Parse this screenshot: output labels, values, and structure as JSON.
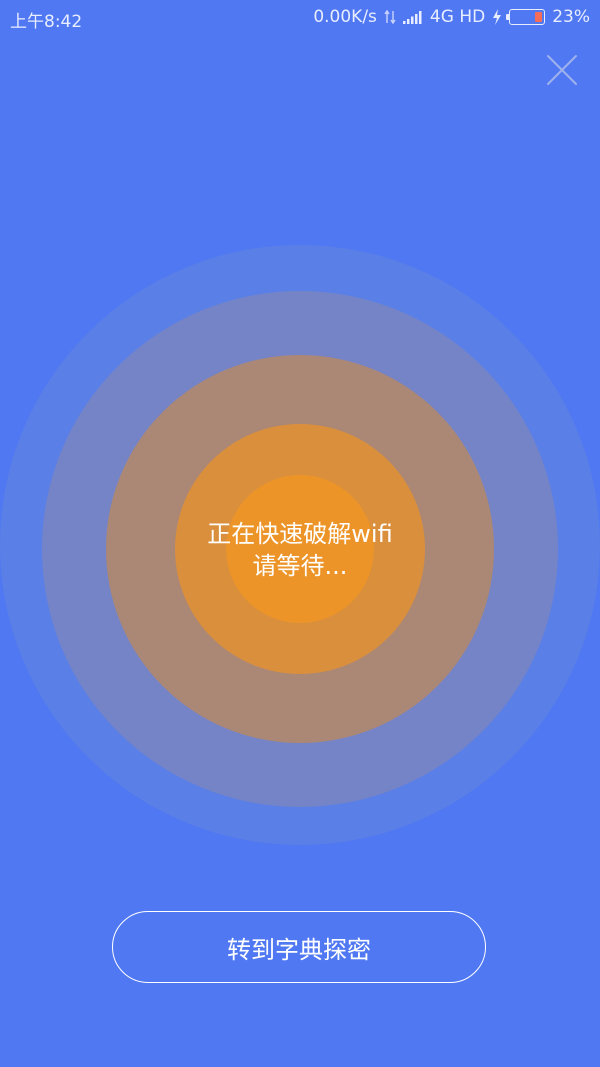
{
  "colors": {
    "background": "#5078F2",
    "ring_outer": "#5A7FE6",
    "ring_2": "#7584C6",
    "ring_3": "#AB8776",
    "ring_4": "#DA8F3D",
    "ring_core": "#EC9428",
    "battery_fill": "#F46C5A"
  },
  "status_bar": {
    "time": "上午8:42",
    "network_speed": "0.00K/s",
    "network_type": "4G HD",
    "battery_percent": "23%",
    "battery_level": 0.23,
    "icons": [
      "data-transfer-icon",
      "signal-icon",
      "charging-icon",
      "battery-icon"
    ]
  },
  "close_button": {
    "icon": "close-icon"
  },
  "scan": {
    "line1": "正在快速破解wifi",
    "line2": "请等待..."
  },
  "actions": {
    "dictionary_button": "转到字典探密"
  }
}
